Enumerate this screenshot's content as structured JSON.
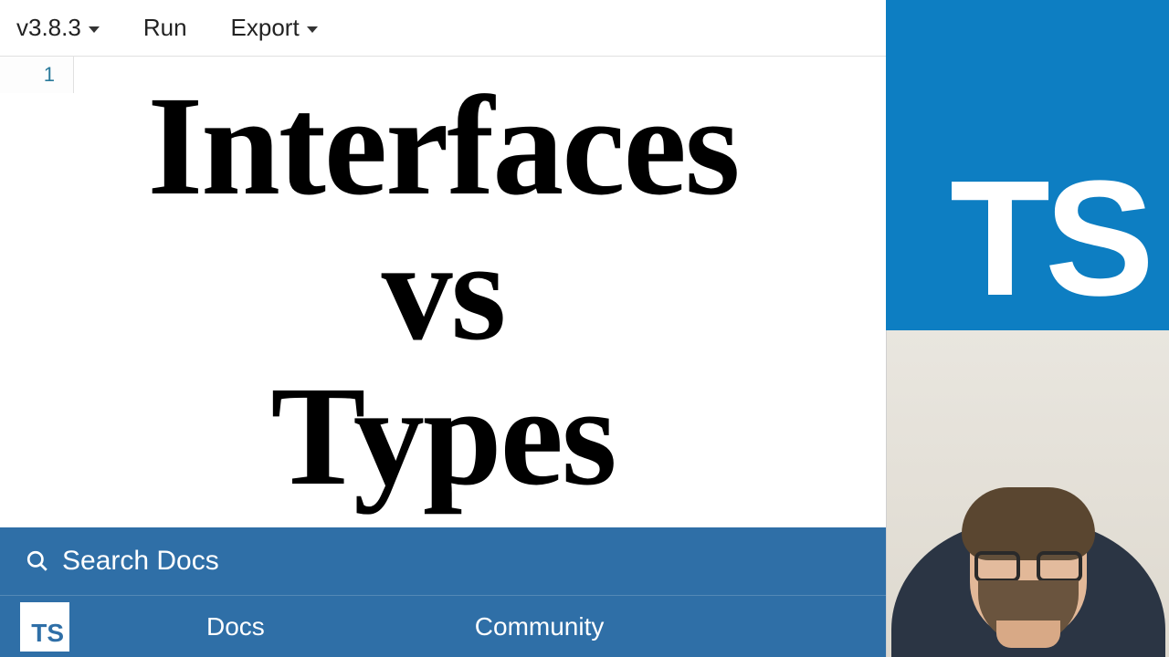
{
  "toolbar": {
    "version_label": "v3.8.3",
    "run_label": "Run",
    "export_label": "Export"
  },
  "editor": {
    "line_number": "1",
    "content": ""
  },
  "headline": {
    "line1": "Interfaces",
    "line2": "vs",
    "line3": "Types"
  },
  "search": {
    "placeholder": "Search Docs"
  },
  "nav": {
    "logo_text": "TS",
    "items": [
      "Docs",
      "Community"
    ]
  },
  "logo": {
    "text": "TS"
  },
  "colors": {
    "ts_blue": "#0d7ec2",
    "nav_blue": "#2f6fa7"
  }
}
